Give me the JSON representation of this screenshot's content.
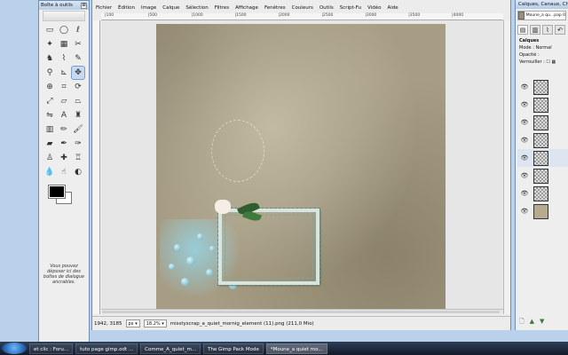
{
  "toolbox": {
    "title": "Boîte à outils",
    "close": "⊠",
    "note": "Vous pouvez déposer ici des boîtes de dialogue ancrables.",
    "tools": [
      {
        "icon": "rect-select-icon",
        "glyph": "▭"
      },
      {
        "icon": "ellipse-select-icon",
        "glyph": "◯"
      },
      {
        "icon": "lasso-icon",
        "glyph": "ℓ"
      },
      {
        "icon": "fuzzy-select-icon",
        "glyph": "✦"
      },
      {
        "icon": "color-select-icon",
        "glyph": "▦"
      },
      {
        "icon": "scissors-icon",
        "glyph": "✂"
      },
      {
        "icon": "foreground-select-icon",
        "glyph": "♞"
      },
      {
        "icon": "paths-icon",
        "glyph": "⌇"
      },
      {
        "icon": "color-picker-icon",
        "glyph": "✎"
      },
      {
        "icon": "zoom-icon",
        "glyph": "⚲"
      },
      {
        "icon": "measure-icon",
        "glyph": "⊾"
      },
      {
        "icon": "move-icon",
        "glyph": "✥"
      },
      {
        "icon": "align-icon",
        "glyph": "⊕"
      },
      {
        "icon": "crop-icon",
        "glyph": "⌗"
      },
      {
        "icon": "rotate-icon",
        "glyph": "⟳"
      },
      {
        "icon": "scale-icon",
        "glyph": "⤢"
      },
      {
        "icon": "shear-icon",
        "glyph": "▱"
      },
      {
        "icon": "perspective-icon",
        "glyph": "⏢"
      },
      {
        "icon": "flip-icon",
        "glyph": "⇋"
      },
      {
        "icon": "text-icon",
        "glyph": "A"
      },
      {
        "icon": "bucket-fill-icon",
        "glyph": "♜"
      },
      {
        "icon": "blend-icon",
        "glyph": "▥"
      },
      {
        "icon": "pencil-icon",
        "glyph": "✏"
      },
      {
        "icon": "paintbrush-icon",
        "glyph": "🖌"
      },
      {
        "icon": "eraser-icon",
        "glyph": "▰"
      },
      {
        "icon": "airbrush-icon",
        "glyph": "✒"
      },
      {
        "icon": "ink-icon",
        "glyph": "✑"
      },
      {
        "icon": "clone-icon",
        "glyph": "♙"
      },
      {
        "icon": "heal-icon",
        "glyph": "✚"
      },
      {
        "icon": "perspective-clone-icon",
        "glyph": "♖"
      },
      {
        "icon": "blur-icon",
        "glyph": "💧"
      },
      {
        "icon": "smudge-icon",
        "glyph": "☝"
      },
      {
        "icon": "dodge-burn-icon",
        "glyph": "◐"
      }
    ],
    "active_tool_index": 11,
    "fg_color": "#000000",
    "bg_color": "#ffffff"
  },
  "image_window": {
    "menu": [
      "Fichier",
      "Édition",
      "Image",
      "Calque",
      "Sélection",
      "Filtres",
      "Affichage",
      "Fenêtres",
      "Couleurs",
      "Outils",
      "Script-Fu",
      "Vidéo",
      "Aide"
    ],
    "ruler_ticks": [
      "100",
      "500",
      "1000",
      "1500",
      "2000",
      "2500",
      "3000",
      "3500",
      "4000"
    ],
    "status": {
      "coords": "1942, 3185",
      "unit": "px",
      "zoom": "18.2%",
      "message": "misstyscrap_a_quiet_mornig_element (11).png (211,0 Mio)"
    }
  },
  "layers_dock": {
    "title": "Calques, Canaux, Che",
    "image_name": "Moune_a qu...pap 0",
    "section": "Calques",
    "mode_label": "Mode :",
    "mode_value": "Normal",
    "opacity_label": "Opacité :",
    "lock_label": "Verrouiller :",
    "layer_count": 8,
    "selected_layer_index": 4
  },
  "taskbar": {
    "items": [
      {
        "label": "et clic : Foru...",
        "active": false
      },
      {
        "label": "tuto page gimp.odt ...",
        "active": false
      },
      {
        "label": "Comme_A_quiet_m...",
        "active": false
      },
      {
        "label": "The Gimp Pack Mode",
        "active": false
      },
      {
        "label": "*Moune_a quiet mo...",
        "active": true
      }
    ]
  }
}
